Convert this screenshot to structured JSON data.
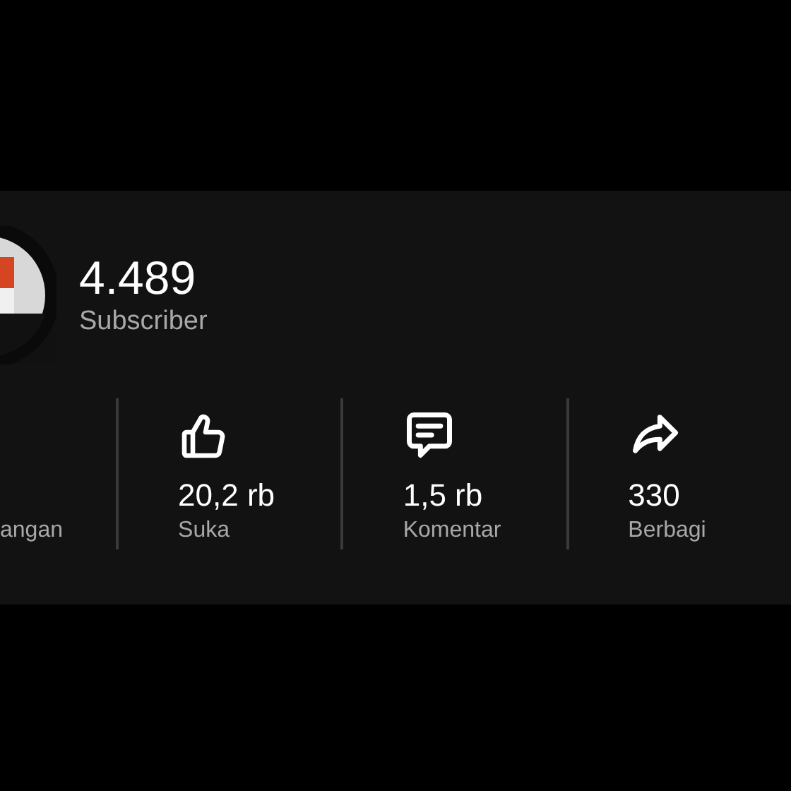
{
  "channel": {
    "subscriber_count": "4.489",
    "subscriber_label": "Subscriber"
  },
  "stats": [
    {
      "label": "angan"
    },
    {
      "kind": "like",
      "value": "20,2 rb",
      "label": "Suka"
    },
    {
      "kind": "comment",
      "value": "1,5 rb",
      "label": "Komentar"
    },
    {
      "kind": "share",
      "value": "330",
      "label": "Berbagi"
    }
  ]
}
